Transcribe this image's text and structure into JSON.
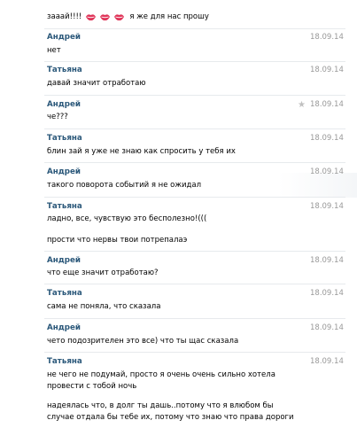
{
  "first": {
    "prefix": "зааай!!!!",
    "suffix": "я же для нас прошу"
  },
  "messages": [
    {
      "name": "Андрей",
      "date": "18.09.14",
      "lines": [
        "нет"
      ]
    },
    {
      "name": "Татьяна",
      "date": "18.09.14",
      "lines": [
        "давай значит отработаю"
      ]
    },
    {
      "name": "Андрей",
      "date": "18.09.14",
      "lines": [
        "че???"
      ]
    },
    {
      "name": "Татьяна",
      "date": "18.09.14",
      "lines": [
        "блин зай я уже не знаю как спросить у тебя их"
      ]
    },
    {
      "name": "Андрей",
      "date": "18.09.14",
      "lines": [
        "такого поворота событий я не ожидал"
      ]
    },
    {
      "name": "Татьяна",
      "date": "18.09.14",
      "lines": [
        "ладно, все, чувствую это бесполезно!(((",
        "прости что нервы твои потрепалаэ"
      ]
    },
    {
      "name": "Андрей",
      "date": "18.09.14",
      "lines": [
        "что еще значит отработаю?"
      ]
    },
    {
      "name": "Татьяна",
      "date": "18.09.14",
      "lines": [
        "сама не поняла, что сказала"
      ]
    },
    {
      "name": "Андрей",
      "date": "18.09.14",
      "lines": [
        "чето подозрителен это все) что ты щас сказала"
      ]
    },
    {
      "name": "Татьяна",
      "date": "18.09.14",
      "lines": [
        "не чего не подумай, просто я очень очень сильно хотела",
        "провести с тобой ночь",
        "надеялась что, в долг ты дашь..потому что я влюбом бы",
        "случае отдала бы тебе их, потому что знаю что права дороги"
      ]
    }
  ],
  "icons": {
    "kiss": "kiss-lips-icon",
    "star": "star-icon"
  },
  "colors": {
    "name": "#2b587a",
    "date": "#999999",
    "kiss": "#e0365a"
  }
}
